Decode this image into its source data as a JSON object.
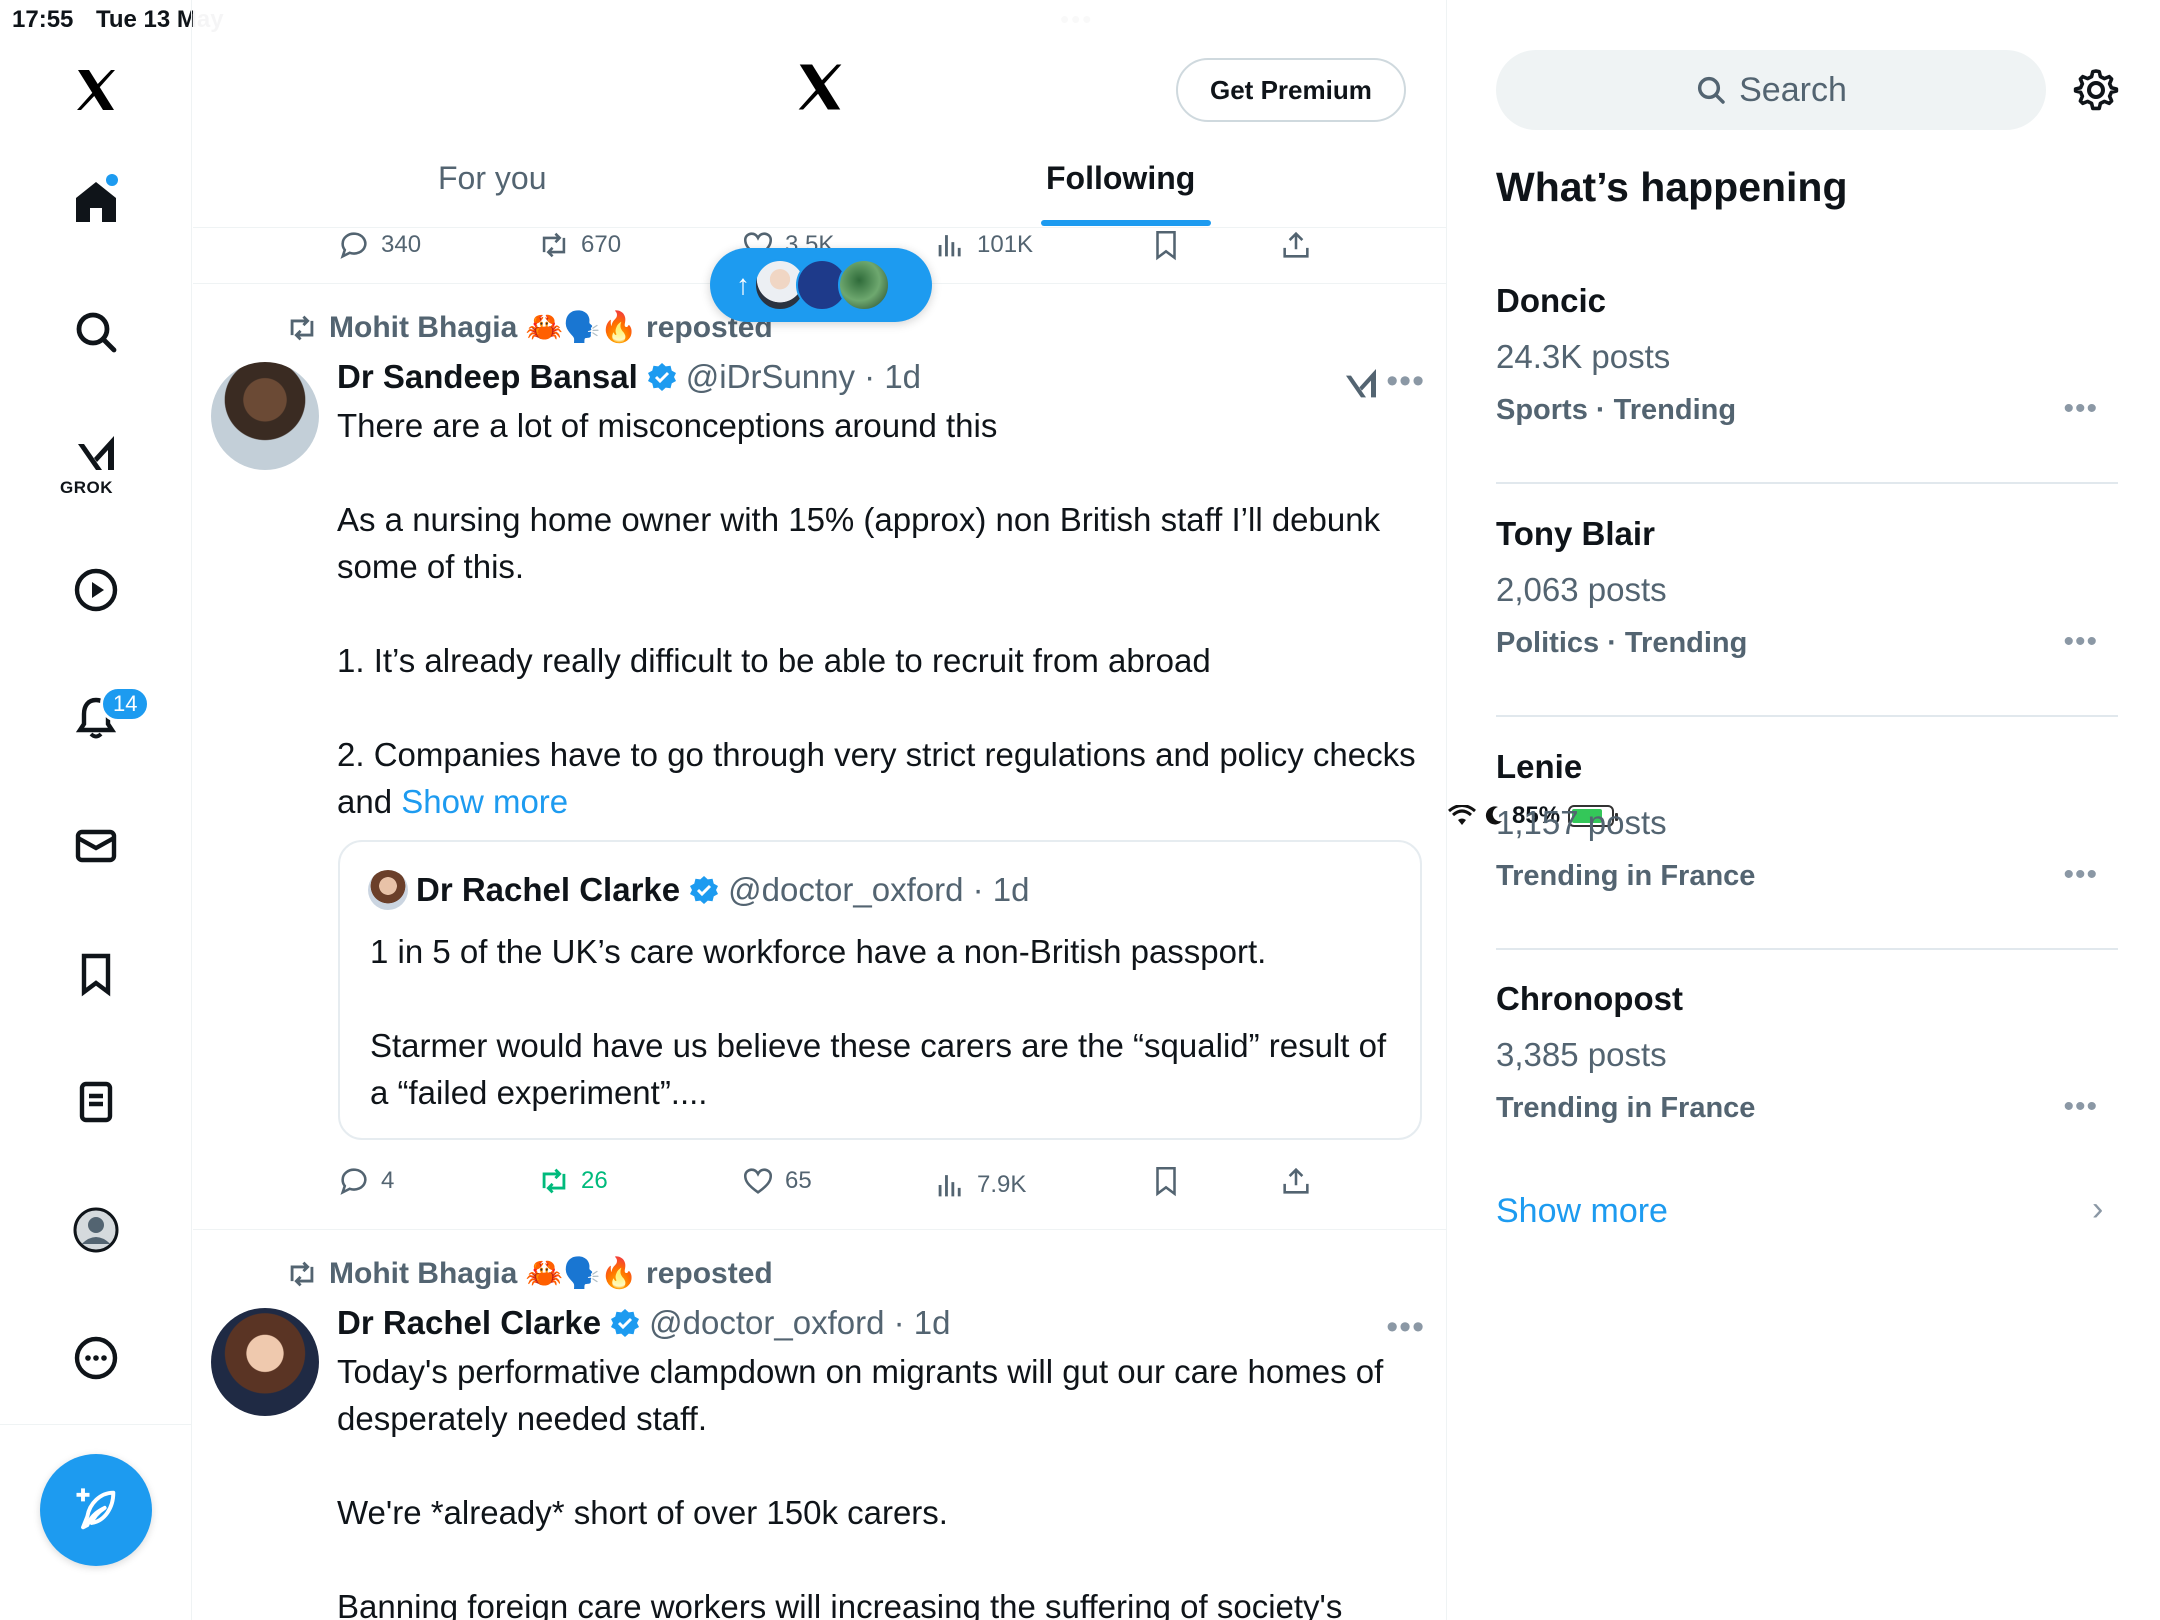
{
  "status_bar": {
    "time": "17:55",
    "date": "Tue 13 May",
    "battery": "85%"
  },
  "nav": {
    "grok_label": "GROK",
    "notifications_badge": "14"
  },
  "header": {
    "premium_label": "Get Premium",
    "tabs": [
      "For you",
      "Following"
    ]
  },
  "prev_post_actions": {
    "replies": "340",
    "reposts": "670",
    "likes": "3.5K",
    "views": "101K"
  },
  "posts": [
    {
      "repost_by": "Mohit Bhagia 🦀🗣️🔥 reposted",
      "name": "Dr Sandeep Bansal",
      "handle": "@iDrSunny · 1d",
      "text": [
        "There are a lot of misconceptions around this",
        "As a nursing home owner with 15% (approx) non British staff I’ll debunk some of this.",
        "1. It’s already really difficult to be able to recruit from abroad",
        "2. Companies have to go through very strict regulations and policy checks and "
      ],
      "show_more": "Show more",
      "quote": {
        "name": "Dr Rachel Clarke",
        "handle": "@doctor_oxford · 1d",
        "text": [
          "1 in 5 of the UK’s care workforce have a non-British passport.",
          "Starmer would have us believe these carers are the “squalid” result of a “failed experiment”...."
        ]
      },
      "actions": {
        "replies": "4",
        "reposts": "26",
        "likes": "65",
        "views": "7.9K"
      }
    },
    {
      "repost_by": "Mohit Bhagia 🦀🗣️🔥 reposted",
      "name": "Dr Rachel Clarke",
      "handle": "@doctor_oxford · 1d",
      "text": [
        "Today's performative clampdown on migrants will gut our care homes of desperately needed staff.",
        "We're *already* short of over 150k carers.",
        "Banning foreign care workers will increasing the suffering of society's"
      ]
    }
  ],
  "sidebar": {
    "search_placeholder": "Search",
    "title": "What’s happening",
    "trends": [
      {
        "name": "Doncic",
        "count": "24.3K posts",
        "category": "Sports · Trending"
      },
      {
        "name": "Tony Blair",
        "count": "2,063 posts",
        "category": "Politics · Trending"
      },
      {
        "name": "Lenie",
        "count": "1,157 posts",
        "category": "Trending in France"
      },
      {
        "name": "Chronopost",
        "count": "3,385 posts",
        "category": "Trending in France"
      }
    ],
    "show_more": "Show more"
  },
  "colors": {
    "accent": "#1d9bf0",
    "repost_green": "#00ba7c",
    "text_secondary": "#536471"
  },
  "icons": [
    "x-logo-icon",
    "home-icon",
    "search-icon",
    "grok-icon",
    "video-icon",
    "bell-icon",
    "mail-icon",
    "bookmark-icon",
    "list-icon",
    "profile-icon",
    "more-icon",
    "compose-icon",
    "gear-icon",
    "reply-icon",
    "repost-icon",
    "like-icon",
    "views-icon",
    "share-icon",
    "verified-icon"
  ]
}
